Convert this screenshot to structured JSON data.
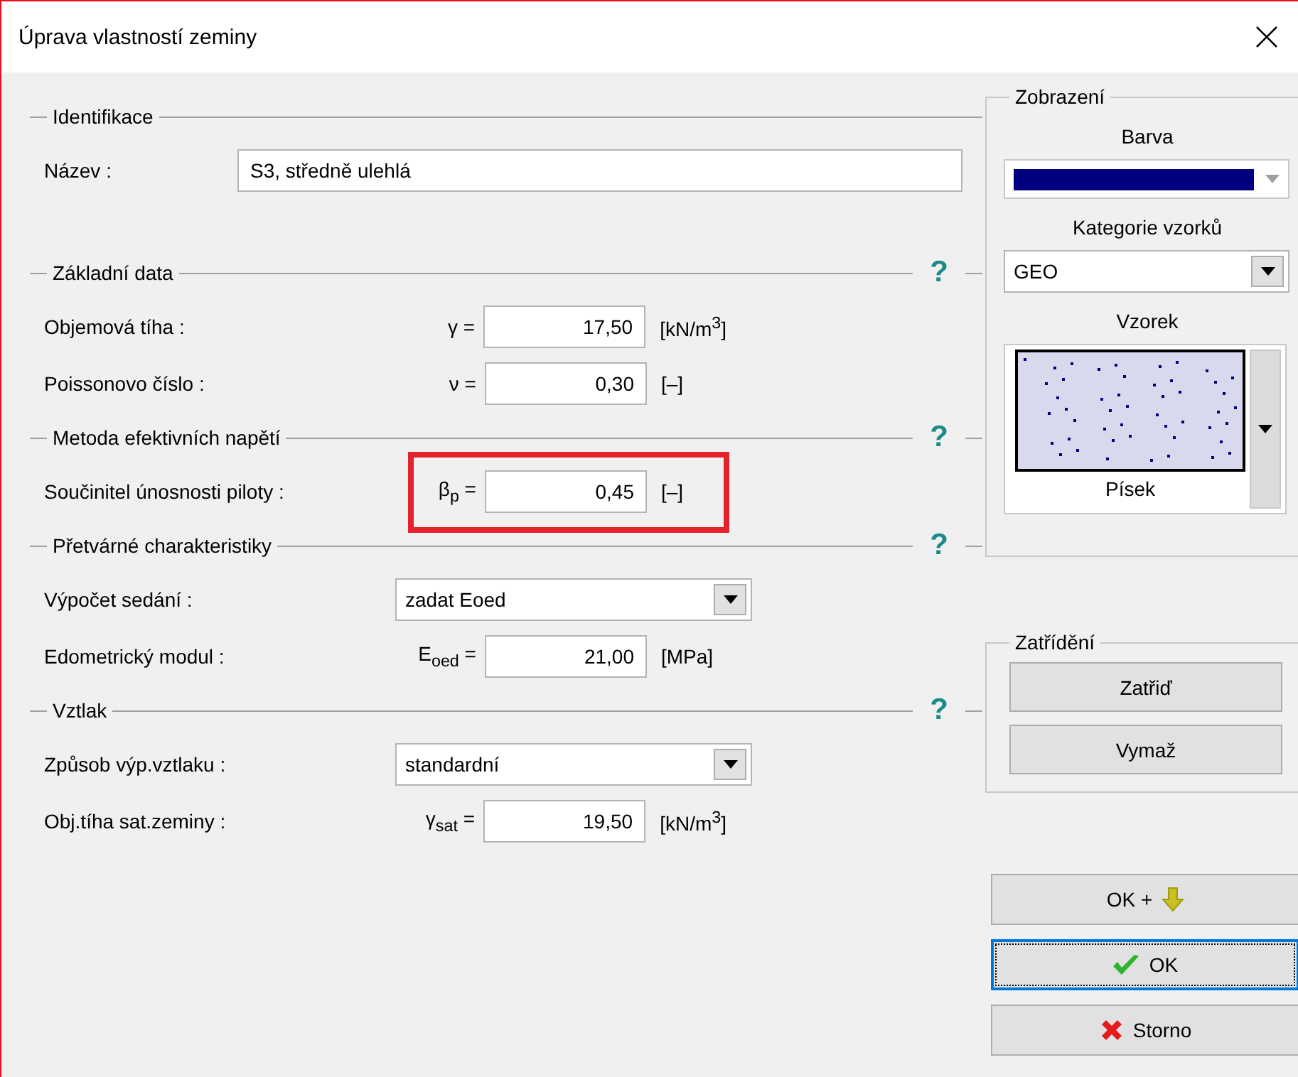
{
  "window": {
    "title": "Úprava vlastností zeminy"
  },
  "sections": [
    {
      "title": "Identifikace",
      "rows": [
        {
          "kind": "text",
          "label": "Název :",
          "value": "S3, středně ulehlá"
        }
      ]
    },
    {
      "title": "Základní data",
      "help": "?",
      "rows": [
        {
          "kind": "value",
          "label": "Objemová tíha :",
          "symbol": "γ =",
          "value": "17,50",
          "unit": "[kN/m$^{3}$]"
        },
        {
          "kind": "value",
          "label": "Poissonovo číslo :",
          "symbol": "ν =",
          "value": "0,30",
          "unit": "[–]"
        }
      ]
    },
    {
      "title": "Metoda efektivních napětí",
      "help": "?",
      "rows": [
        {
          "kind": "value",
          "label": "Součinitel únosnosti piloty :",
          "symbol": "β$_{p}$ =",
          "value": "0,45",
          "unit": "[–]",
          "highlighted": true
        }
      ]
    },
    {
      "title": "Přetvárné charakteristiky",
      "help": "?",
      "rows": [
        {
          "kind": "select",
          "label": "Výpočet sedání :",
          "value": "zadat Eoed"
        },
        {
          "kind": "value",
          "label": "Edometrický modul :",
          "symbol": "E$_{oed}$ =",
          "value": "21,00",
          "unit": "[MPa]"
        }
      ]
    },
    {
      "title": "Vztlak",
      "help": "?",
      "rows": [
        {
          "kind": "select",
          "label": "Způsob výp.vztlaku :",
          "value": "standardní"
        },
        {
          "kind": "value",
          "label": "Obj.tíha sat.zeminy :",
          "symbol": "γ$_{sat}$ =",
          "value": "19,50",
          "unit": "[kN/m$^{3}$]"
        }
      ]
    }
  ],
  "display": {
    "title": "Zobrazení",
    "color_label": "Barva",
    "color": "#000080",
    "category_label": "Kategorie vzorků",
    "category": "GEO",
    "pattern_label": "Vzorek",
    "pattern_name": "Písek"
  },
  "classification": {
    "title": "Zatřídění",
    "buttons": [
      "Zatřiď",
      "Vymaž"
    ]
  },
  "buttons": [
    {
      "kind": "ok_next",
      "label": "OK +",
      "focused": false
    },
    {
      "kind": "ok",
      "label": "OK",
      "focused": true
    },
    {
      "kind": "cancel",
      "label": "Storno",
      "focused": false
    }
  ]
}
